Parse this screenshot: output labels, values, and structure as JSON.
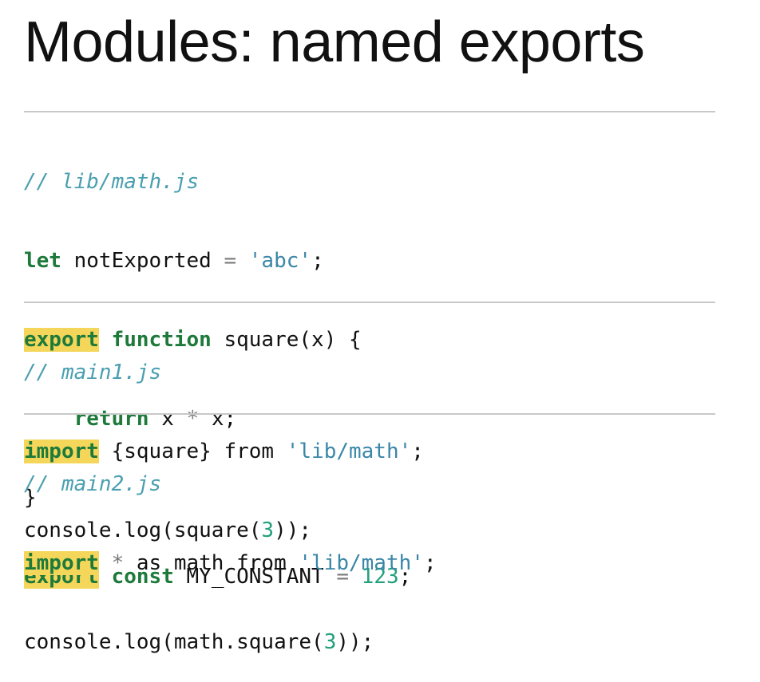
{
  "slide": {
    "title": "Modules: named exports"
  },
  "blocks": [
    {
      "comment": "// lib/math.js",
      "lines": [
        {
          "kw": "let",
          "rest1": " notExported ",
          "op": "=",
          "rest2": " ",
          "str": "'abc'",
          "end": ";"
        },
        {
          "kw_hl": "export",
          "sp": " ",
          "kw": "function",
          "rest": " square(x) {"
        },
        {
          "indent": "    ",
          "kw": "return",
          "rest1": " x ",
          "op": "*",
          "rest2": " x;"
        },
        {
          "text": "}"
        },
        {
          "kw_hl": "export",
          "sp": " ",
          "kw": "const",
          "rest1": " MY_CONSTANT ",
          "op": "=",
          "rest2": " ",
          "num": "123",
          "end": ";"
        }
      ]
    },
    {
      "comment": "// main1.js",
      "lines": [
        {
          "kw_hl": "import",
          "rest": " {square} from ",
          "str": "'lib/math'",
          "end": ";"
        },
        {
          "pre": "console.log(square(",
          "num": "3",
          "end": "));"
        }
      ]
    },
    {
      "comment": "// main2.js",
      "lines": [
        {
          "kw_hl": "import",
          "sp": " ",
          "op": "*",
          "rest": " as math from ",
          "str": "'lib/math'",
          "end": ";"
        },
        {
          "pre": "console.log(math.square(",
          "num": "3",
          "end": "));"
        }
      ]
    }
  ]
}
